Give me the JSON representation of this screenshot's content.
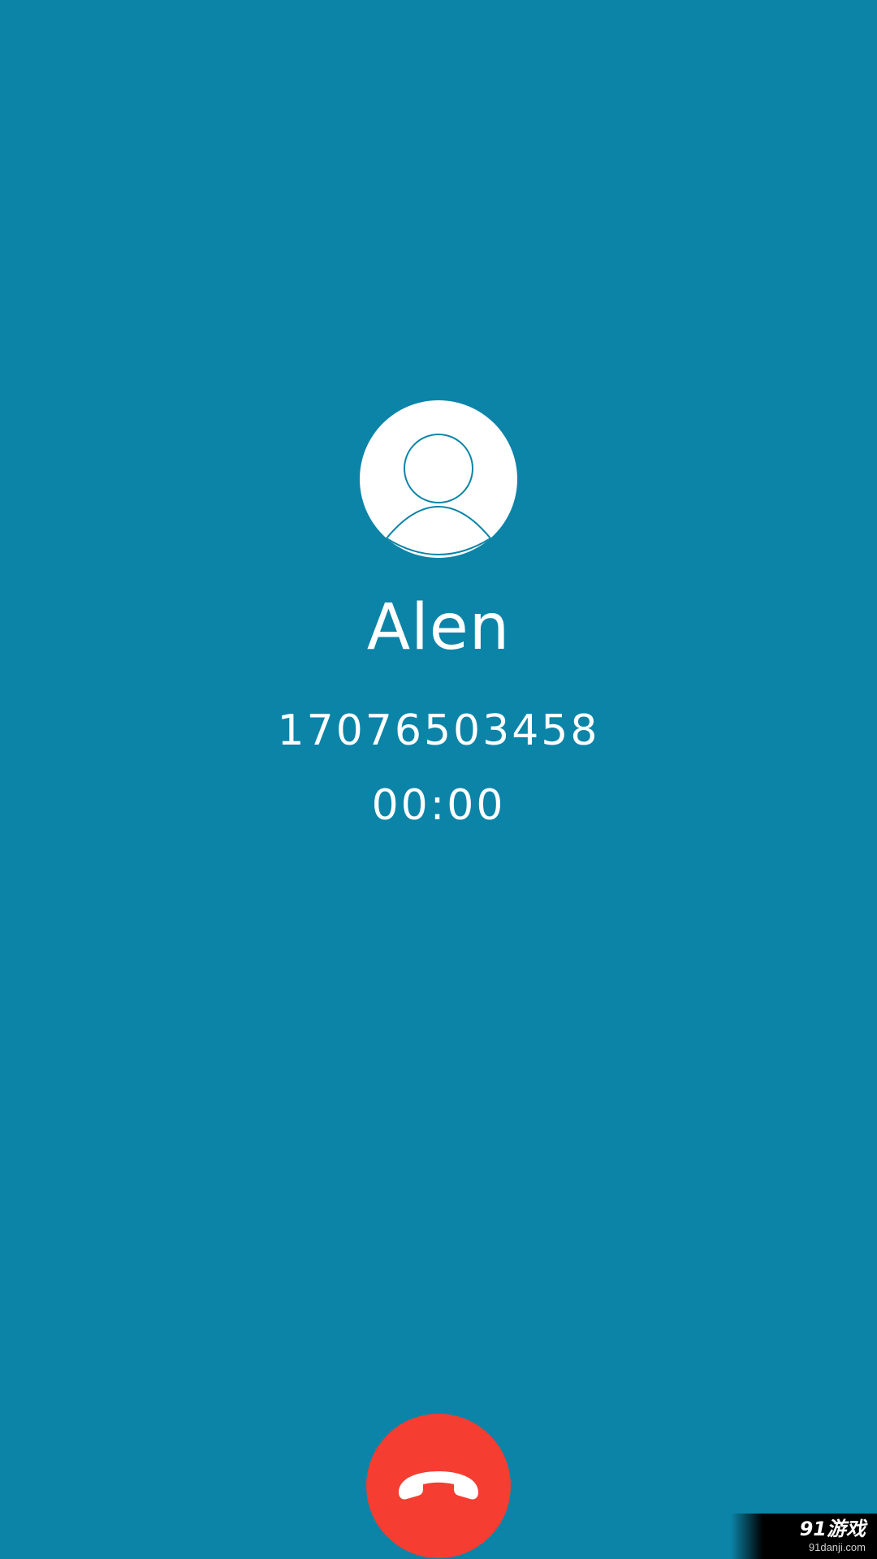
{
  "call": {
    "contact_name": "Alen",
    "phone_number": "17076503458",
    "timer": "00:00"
  },
  "icons": {
    "avatar": "person-silhouette-icon",
    "hangup": "phone-hangup-icon"
  },
  "colors": {
    "background": "#0b84a7",
    "hangup_button": "#f53d32",
    "text": "#ffffff"
  },
  "watermark": {
    "brand": "91游戏",
    "url": "91danji.com"
  }
}
